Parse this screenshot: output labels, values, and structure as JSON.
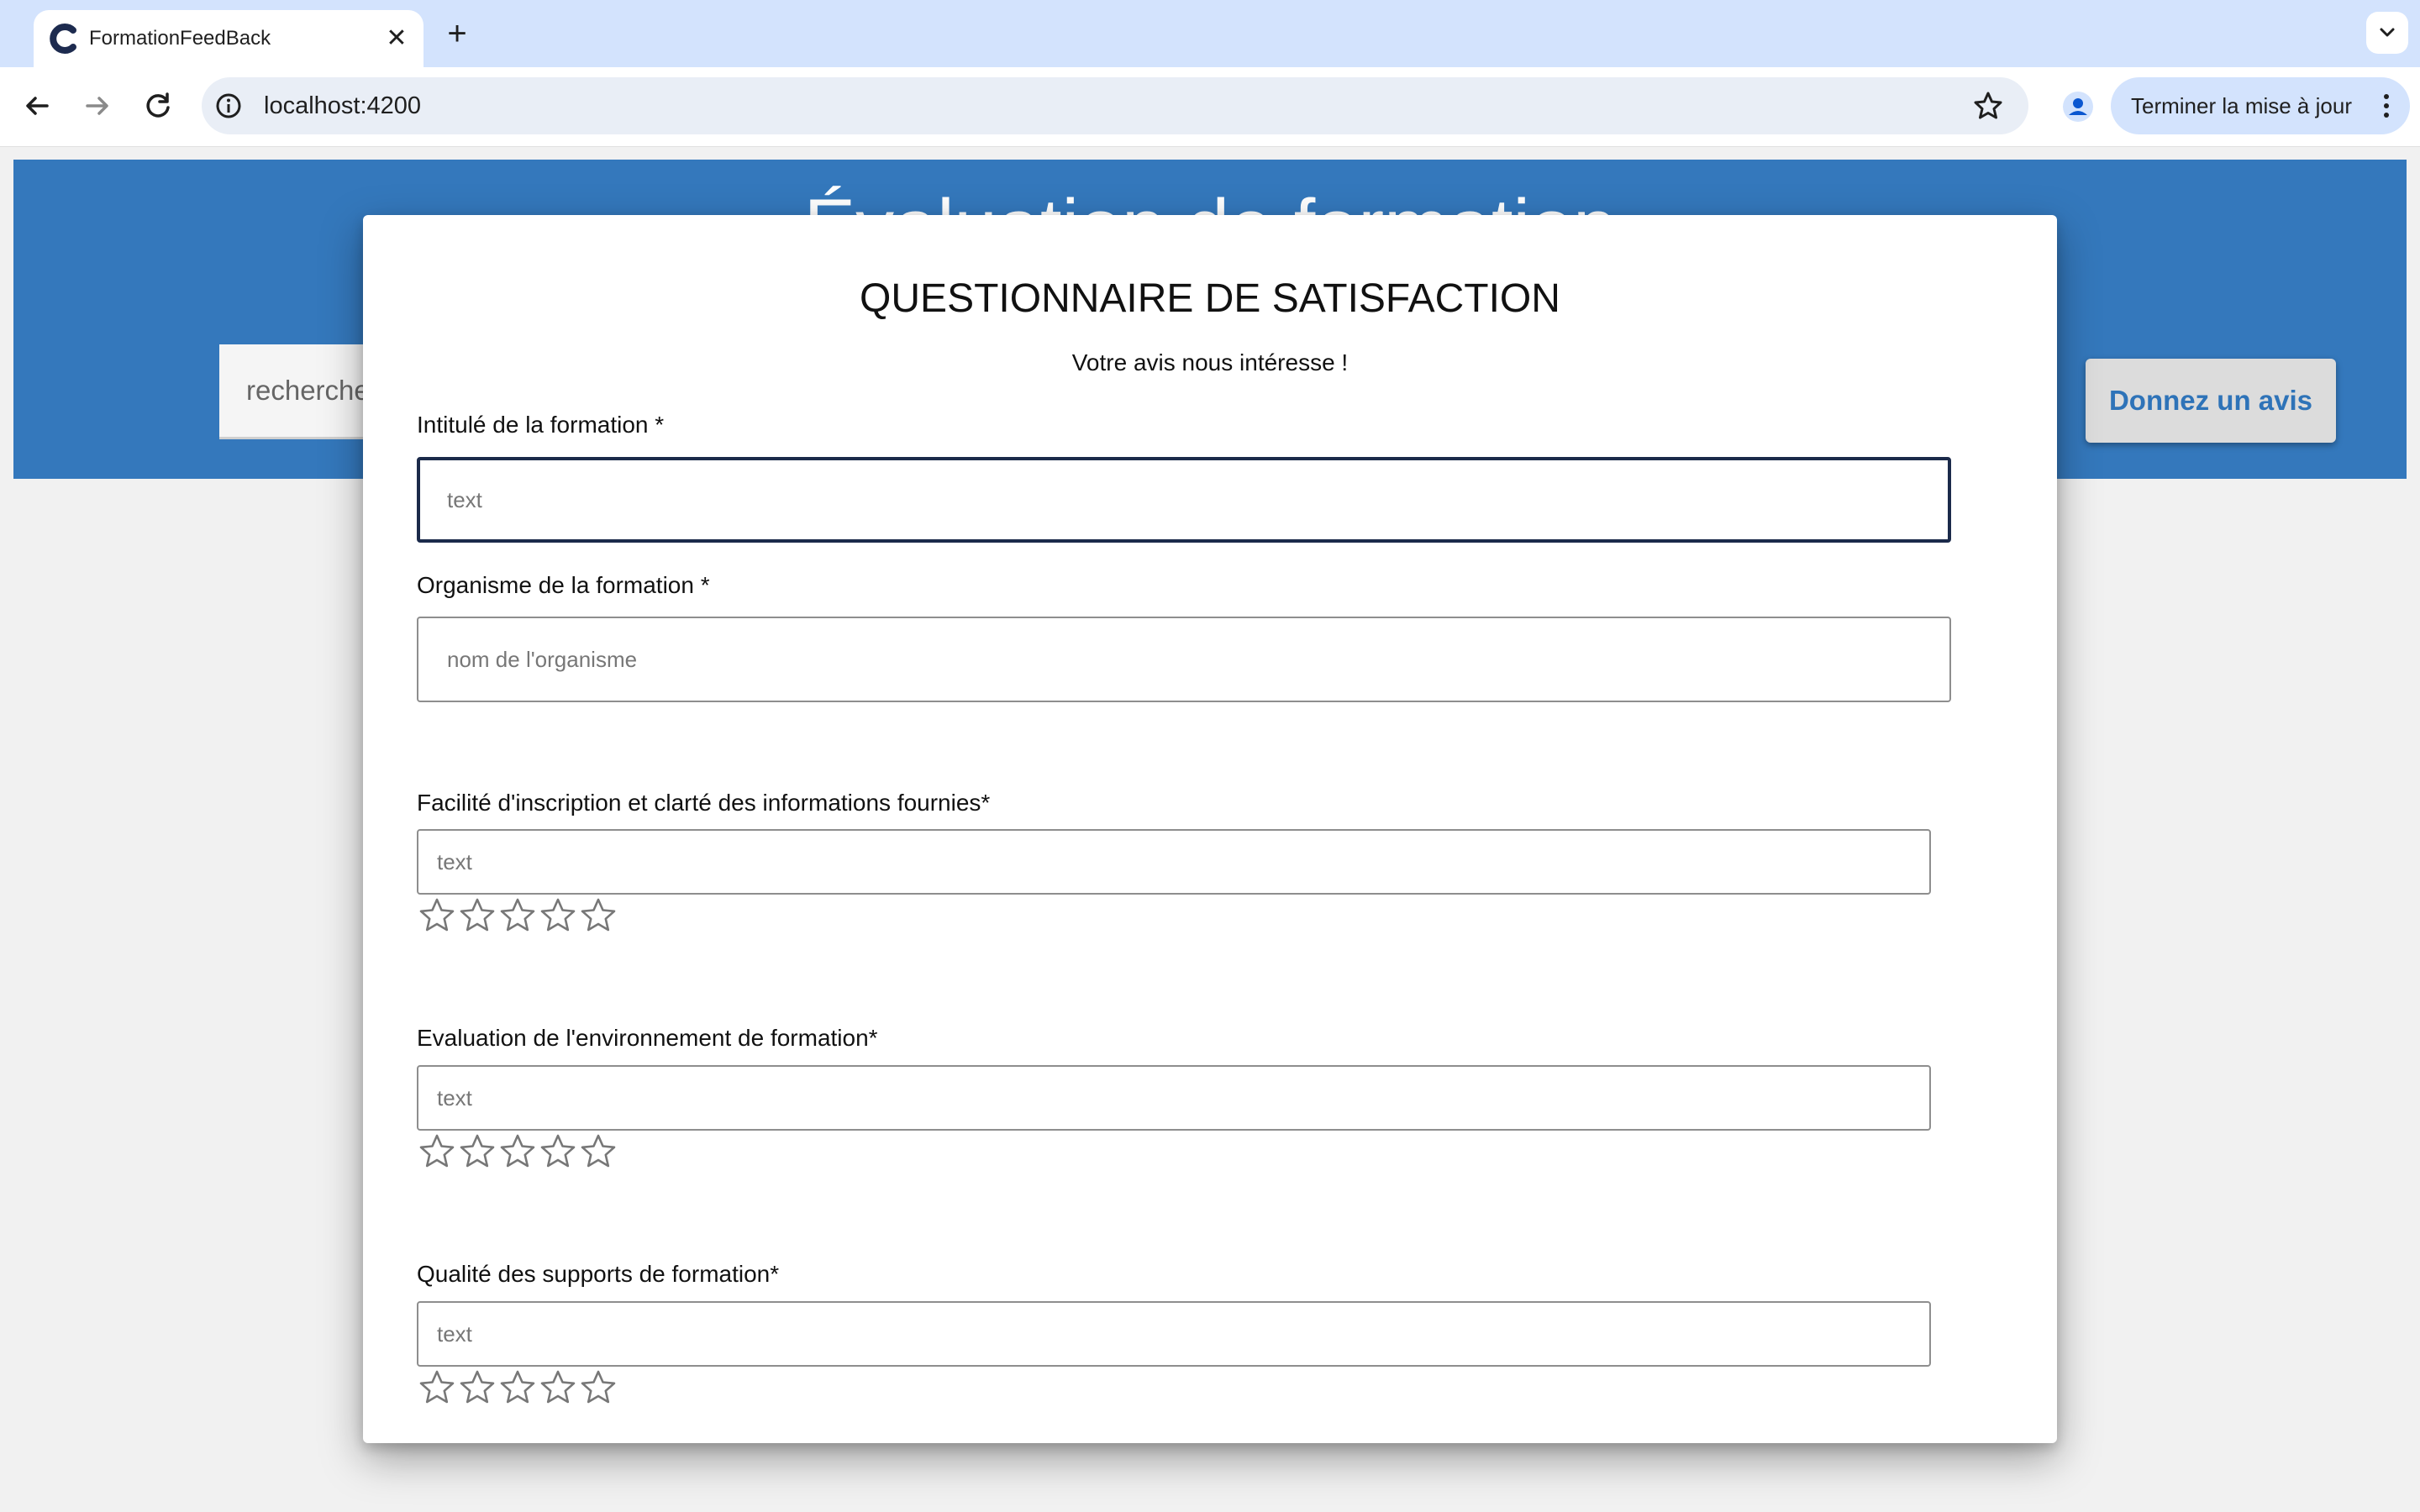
{
  "browser": {
    "tab_title": "FormationFeedBack",
    "url": "localhost:4200",
    "update_label": "Terminer la mise à jour"
  },
  "page": {
    "hero_title": "Évaluation de formation",
    "search_placeholder": "recherche",
    "cta_label": "Donnez un avis"
  },
  "modal": {
    "title": "QUESTIONNAIRE DE SATISFACTION",
    "subtitle": "Votre avis nous intéresse !",
    "fields": [
      {
        "label": "Intitulé de la formation *",
        "placeholder": "text"
      },
      {
        "label": "Organisme de la formation *",
        "placeholder": "nom de l'organisme"
      }
    ],
    "ratings": [
      {
        "label": "Facilité d'inscription et clarté des informations fournies*",
        "placeholder": "text",
        "stars": 0,
        "max": 5
      },
      {
        "label": "Evaluation de l'environnement de formation*",
        "placeholder": "text",
        "stars": 0,
        "max": 5
      },
      {
        "label": "Qualité des supports de formation*",
        "placeholder": "text",
        "stars": 0,
        "max": 5
      }
    ]
  },
  "colors": {
    "hero_blue": "#3478bc",
    "chrome_blue": "#d3e3fd",
    "cta_text": "#2e73b8",
    "focus_border": "#1b2a4a"
  },
  "icons": [
    "app-favicon-icon",
    "close-icon",
    "plus-icon",
    "chevron-down-icon",
    "back-arrow-icon",
    "forward-arrow-icon",
    "reload-icon",
    "info-icon",
    "star-outline-icon",
    "profile-icon",
    "more-vert-icon"
  ]
}
